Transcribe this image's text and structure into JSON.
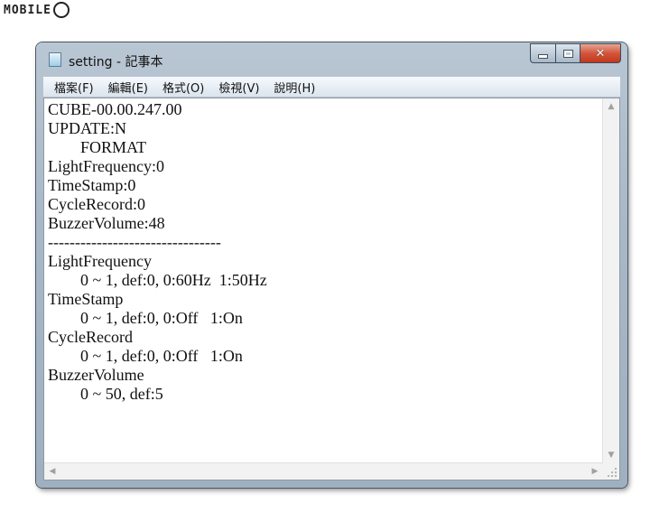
{
  "watermark": {
    "text": "MOBILE"
  },
  "window": {
    "title": "setting - 記事本",
    "icon": "notepad-icon",
    "caption_icons": [
      "minimize-icon",
      "maximize-icon",
      "close-icon"
    ]
  },
  "menu": {
    "items": [
      {
        "label": "檔案(F)"
      },
      {
        "label": "編輯(E)"
      },
      {
        "label": "格式(O)"
      },
      {
        "label": "檢視(V)"
      },
      {
        "label": "說明(H)"
      }
    ]
  },
  "editor": {
    "content": "CUBE-00.00.247.00\nUPDATE:N\n        FORMAT\nLightFrequency:0\nTimeStamp:0\nCycleRecord:0\nBuzzerVolume:48\n--------------------------------\nLightFrequency\n        0 ~ 1, def:0, 0:60Hz  1:50Hz\nTimeStamp\n        0 ~ 1, def:0, 0:Off   1:On\nCycleRecord\n        0 ~ 1, def:0, 0:Off   1:On\nBuzzerVolume\n        0 ~ 50, def:5"
  }
}
